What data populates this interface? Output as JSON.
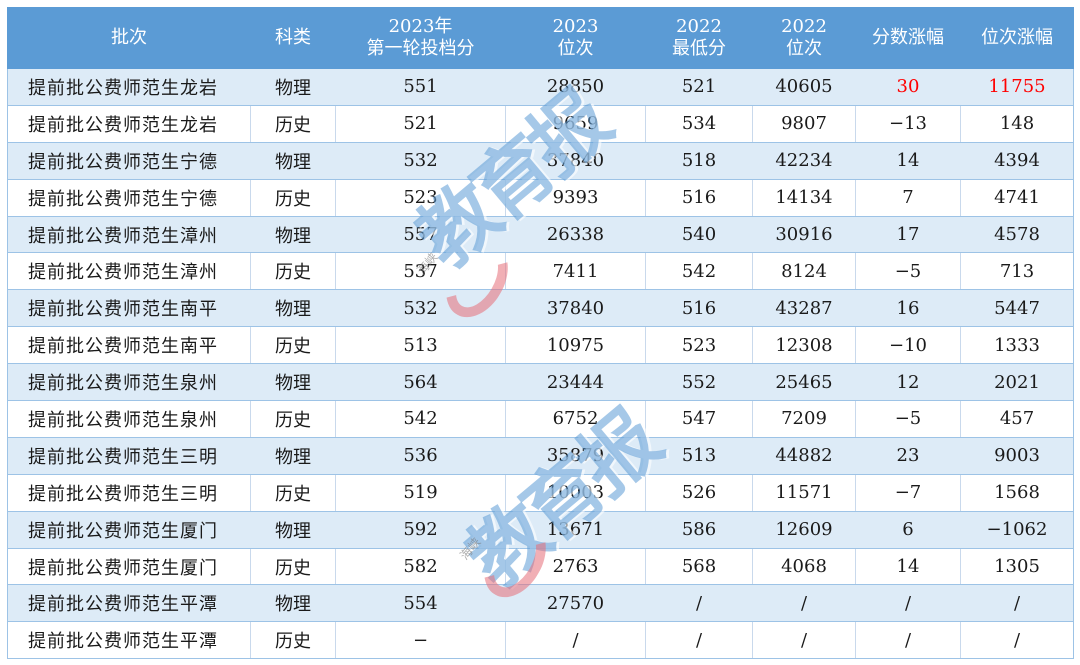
{
  "table": {
    "headers": [
      "批次",
      "科类",
      "2023年\n第一轮投档分",
      "2023\n位次",
      "2022\n最低分",
      "2022\n位次",
      "分数涨幅",
      "位次涨幅"
    ],
    "rows": [
      [
        "提前批公费师范生龙岩",
        "物理",
        "551",
        "28850",
        "521",
        "40605",
        "30",
        "11755"
      ],
      [
        "提前批公费师范生龙岩",
        "历史",
        "521",
        "9659",
        "534",
        "9807",
        "−13",
        "148"
      ],
      [
        "提前批公费师范生宁德",
        "物理",
        "532",
        "37840",
        "518",
        "42234",
        "14",
        "4394"
      ],
      [
        "提前批公费师范生宁德",
        "历史",
        "523",
        "9393",
        "516",
        "14134",
        "7",
        "4741"
      ],
      [
        "提前批公费师范生漳州",
        "物理",
        "557",
        "26338",
        "540",
        "30916",
        "17",
        "4578"
      ],
      [
        "提前批公费师范生漳州",
        "历史",
        "537",
        "7411",
        "542",
        "8124",
        "−5",
        "713"
      ],
      [
        "提前批公费师范生南平",
        "物理",
        "532",
        "37840",
        "516",
        "43287",
        "16",
        "5447"
      ],
      [
        "提前批公费师范生南平",
        "历史",
        "513",
        "10975",
        "523",
        "12308",
        "−10",
        "1333"
      ],
      [
        "提前批公费师范生泉州",
        "物理",
        "564",
        "23444",
        "552",
        "25465",
        "12",
        "2021"
      ],
      [
        "提前批公费师范生泉州",
        "历史",
        "542",
        "6752",
        "547",
        "7209",
        "−5",
        "457"
      ],
      [
        "提前批公费师范生三明",
        "物理",
        "536",
        "35879",
        "513",
        "44882",
        "23",
        "9003"
      ],
      [
        "提前批公费师范生三明",
        "历史",
        "519",
        "10003",
        "526",
        "11571",
        "−7",
        "1568"
      ],
      [
        "提前批公费师范生厦门",
        "物理",
        "592",
        "13671",
        "586",
        "12609",
        "6",
        "−1062"
      ],
      [
        "提前批公费师范生厦门",
        "历史",
        "582",
        "2763",
        "568",
        "4068",
        "14",
        "1305"
      ],
      [
        "提前批公费师范生平潭",
        "物理",
        "554",
        "27570",
        "/",
        "/",
        "/",
        "/"
      ],
      [
        "提前批公费师范生平潭",
        "历史",
        "−",
        "/",
        "/",
        "/",
        "/",
        "/"
      ]
    ],
    "highlight": {
      "row": 0,
      "columns": [
        6,
        7
      ],
      "color": "#ff0000"
    }
  },
  "watermark": {
    "text": "教育报",
    "small_text": "海峡"
  },
  "colors": {
    "header_bg": "#5b9bd5",
    "stripe_bg": "#ddebf7",
    "highlight": "#ff0000"
  }
}
